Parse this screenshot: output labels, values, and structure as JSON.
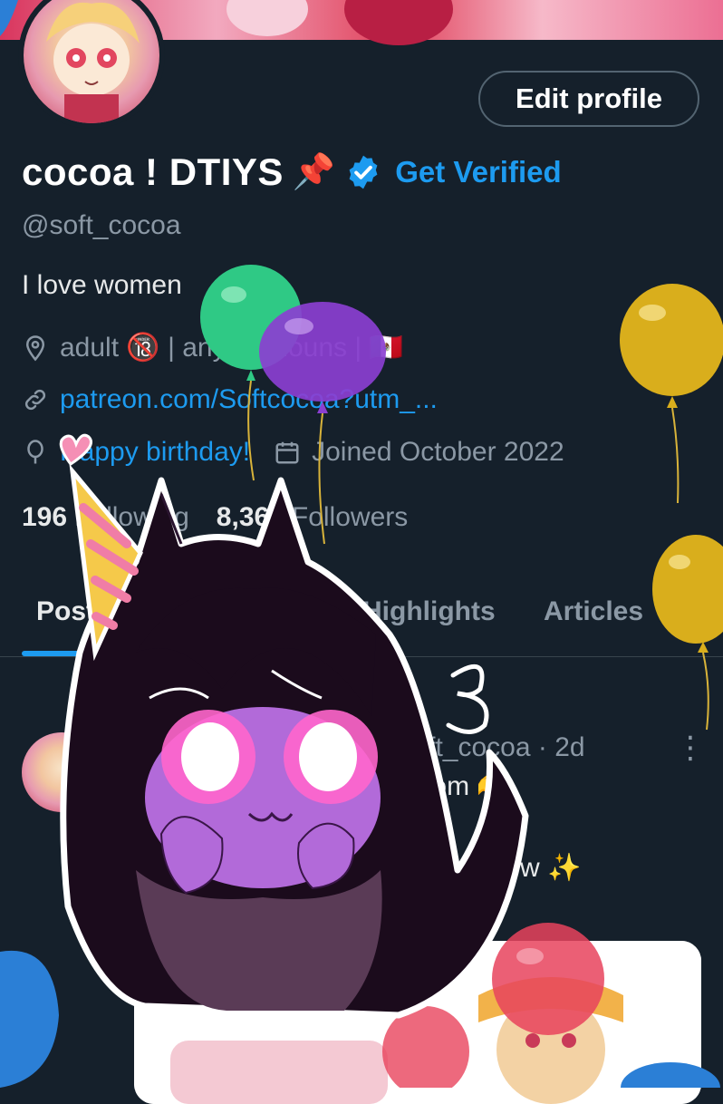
{
  "profile": {
    "display_name": "cocoa ! DTIYS",
    "name_emoji": "📌",
    "get_verified_label": "Get Verified",
    "handle": "@soft_cocoa",
    "bio": "I love women",
    "location": "adult 🔞 | any pronouns | 🇲🇽",
    "website": "patreon.com/Softcocoa?utm_...",
    "birthday": "Happy birthday!",
    "joined": "Joined October 2022",
    "following_count": "196",
    "following_label": "Following",
    "followers_count": "8,365",
    "followers_label": "Followers"
  },
  "edit_profile_label": "Edit profile",
  "tabs": [
    {
      "label": "Posts"
    },
    {
      "label": "Highlights"
    },
    {
      "label": "Articles"
    }
  ],
  "post": {
    "meta": "@soft_cocoa · 2d",
    "text_line1": "her hom 🫶",
    "text_line2": "w ✨",
    "menu_icon": "more-vertical-icon"
  },
  "colors": {
    "background": "#15202b",
    "accent": "#1d9bf0",
    "muted_text": "#8b98a5",
    "primary_text": "#e7e9ea"
  },
  "icons": [
    "location-pin-icon",
    "link-icon",
    "balloon-icon",
    "calendar-icon",
    "verified-badge-icon"
  ]
}
